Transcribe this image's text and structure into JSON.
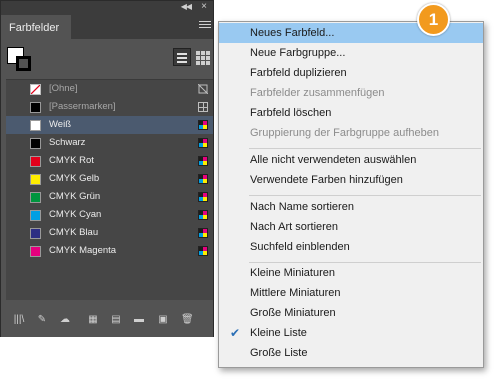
{
  "panel": {
    "title": "Farbfelder",
    "swatches": [
      {
        "label": "[Ohne]",
        "color": "none",
        "dim": true,
        "icon": "no-edit-icon"
      },
      {
        "label": "[Passermarken]",
        "color": "#000000",
        "dim": true,
        "icon": "registration-icon"
      },
      {
        "label": "Weiß",
        "color": "#ffffff",
        "dim": false,
        "icon": "cmyk-process-icon",
        "selected": true
      },
      {
        "label": "Schwarz",
        "color": "#000000",
        "dim": false,
        "icon": "cmyk-process-icon"
      },
      {
        "label": "CMYK Rot",
        "color": "#e3001b",
        "dim": false,
        "icon": "cmyk-process-icon"
      },
      {
        "label": "CMYK Gelb",
        "color": "#ffed00",
        "dim": false,
        "icon": "cmyk-process-icon"
      },
      {
        "label": "CMYK Grün",
        "color": "#00963f",
        "dim": false,
        "icon": "cmyk-process-icon"
      },
      {
        "label": "CMYK Cyan",
        "color": "#009fe3",
        "dim": false,
        "icon": "cmyk-process-icon"
      },
      {
        "label": "CMYK Blau",
        "color": "#2d2e83",
        "dim": false,
        "icon": "cmyk-process-icon"
      },
      {
        "label": "CMYK Magenta",
        "color": "#e6007e",
        "dim": false,
        "icon": "cmyk-process-icon"
      }
    ],
    "bottom_icons": [
      "swatch-libraries-icon",
      "color-theme-icon",
      "cc-library-icon",
      "show-all-swatches-icon",
      "swatch-options-icon",
      "new-color-group-icon",
      "new-swatch-icon",
      "delete-icon"
    ]
  },
  "menu": {
    "items": [
      {
        "label": "Neues Farbfeld...",
        "highlight": true
      },
      {
        "label": "Neue Farbgruppe..."
      },
      {
        "label": "Farbfeld duplizieren"
      },
      {
        "label": "Farbfelder zusammenfügen",
        "disabled": true
      },
      {
        "label": "Farbfeld löschen"
      },
      {
        "label": "Gruppierung der Farbgruppe aufheben",
        "disabled": true
      },
      {
        "label": "Alle nicht verwendeten auswählen"
      },
      {
        "label": "Verwendete Farben hinzufügen"
      },
      {
        "label": "Nach Name sortieren"
      },
      {
        "label": "Nach Art sortieren"
      },
      {
        "label": "Suchfeld einblenden"
      },
      {
        "label": "Kleine Miniaturen"
      },
      {
        "label": "Mittlere Miniaturen"
      },
      {
        "label": "Große Miniaturen"
      },
      {
        "label": "Kleine Liste",
        "checked": true
      },
      {
        "label": "Große Liste"
      }
    ]
  },
  "badge": {
    "number": "1",
    "color": "#f29a1e"
  },
  "colors": {
    "panel_bg": "#535353",
    "selection": "#4b5a6f",
    "menu_highlight": "#99c9f1"
  }
}
